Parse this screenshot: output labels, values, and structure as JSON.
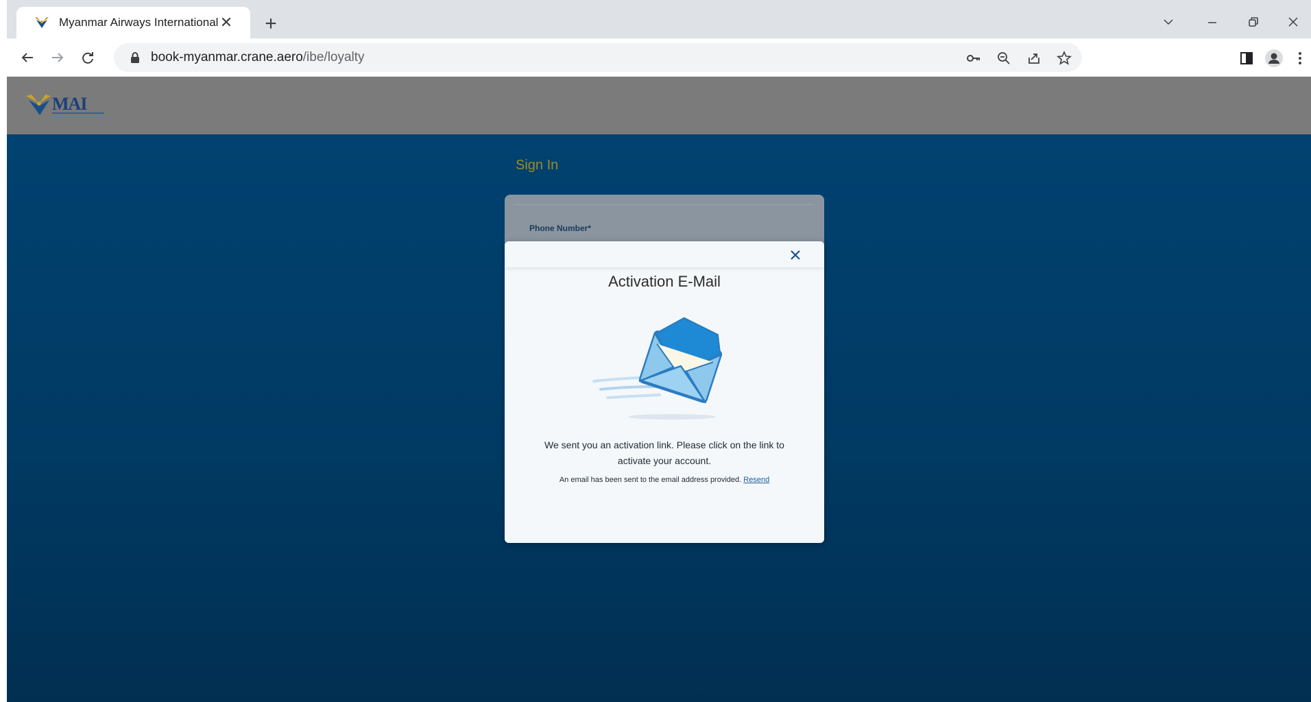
{
  "browser": {
    "tab_title": "Myanmar Airways International",
    "tab_close": "✕",
    "new_tab": "+",
    "url_host": "book-myanmar.crane.aero",
    "url_path": "/ibe/loyalty"
  },
  "site": {
    "logo_text": "MAI"
  },
  "page": {
    "signin_title": "Sign In",
    "phone_label": "Phone Number*"
  },
  "modal": {
    "title": "Activation E-Mail",
    "message": "We sent you an activation link. Please click on the link to activate your account.",
    "note": "An email has been sent to the email address provided.",
    "resend_link": "Resend"
  },
  "colors": {
    "page_background": "#014270",
    "header_background": "#7b7b7b",
    "signin_title": "#a08b26",
    "link": "#1f5fa0"
  },
  "icons": [
    "tab-favicon-icon",
    "close-tab-icon",
    "new-tab-icon",
    "chevron-down-icon",
    "minimize-icon",
    "restore-icon",
    "close-window-icon",
    "back-icon",
    "forward-icon",
    "reload-icon",
    "lock-icon",
    "key-icon",
    "zoom-icon",
    "share-icon",
    "star-icon",
    "sidepanel-icon",
    "profile-icon",
    "menu-icon",
    "close-icon",
    "envelope-icon"
  ]
}
